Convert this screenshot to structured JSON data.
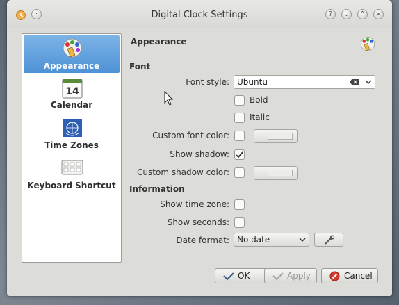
{
  "window": {
    "title": "Digital Clock Settings"
  },
  "sidebar": {
    "items": [
      {
        "label": "Appearance",
        "icon": "appearance-icon",
        "selected": true
      },
      {
        "label": "Calendar",
        "icon": "calendar-icon",
        "calendar_day": "14"
      },
      {
        "label": "Time Zones",
        "icon": "globe-icon"
      },
      {
        "label": "Keyboard Shortcut",
        "icon": "keyboard-icon"
      }
    ]
  },
  "main": {
    "page_title": "Appearance",
    "font_group": {
      "title": "Font",
      "font_style_label": "Font style:",
      "font_style_value": "Ubuntu",
      "bold_label": "Bold",
      "bold_checked": false,
      "italic_label": "Italic",
      "italic_checked": false,
      "custom_font_color_label": "Custom font color:",
      "custom_font_color_checked": false,
      "show_shadow_label": "Show shadow:",
      "show_shadow_checked": true,
      "custom_shadow_color_label": "Custom shadow color:",
      "custom_shadow_color_checked": false
    },
    "info_group": {
      "title": "Information",
      "show_time_zone_label": "Show time zone:",
      "show_time_zone_checked": false,
      "show_seconds_label": "Show seconds:",
      "show_seconds_checked": false,
      "date_format_label": "Date format:",
      "date_format_value": "No date"
    }
  },
  "buttons": {
    "ok": "OK",
    "apply": "Apply",
    "cancel": "Cancel"
  },
  "colors": {
    "selection": "#5b9ddf",
    "window_bg": "#dcdcd8",
    "checkmark": "#333333"
  }
}
